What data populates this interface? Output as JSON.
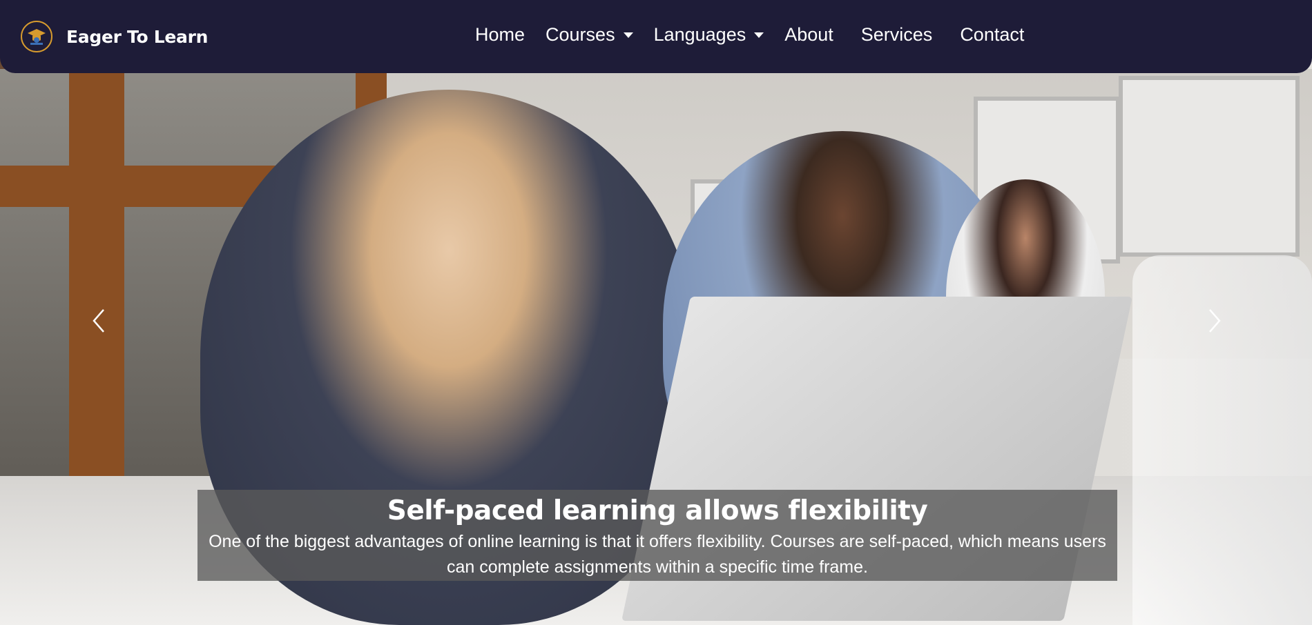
{
  "brand": {
    "name": "Eager To Learn",
    "logo_icon": "graduate-logo-icon"
  },
  "nav": {
    "items": [
      {
        "label": "Home",
        "dropdown": false
      },
      {
        "label": "Courses",
        "dropdown": true
      },
      {
        "label": "Languages",
        "dropdown": true
      },
      {
        "label": "About",
        "dropdown": false
      },
      {
        "label": "Services",
        "dropdown": false
      },
      {
        "label": "Contact",
        "dropdown": false
      }
    ]
  },
  "carousel": {
    "prev_icon": "chevron-left-icon",
    "next_icon": "chevron-right-icon",
    "caption": {
      "title": "Self-paced learning allows flexibility",
      "text": "One of the biggest advantages of online learning is that it offers flexibility. Courses are self-paced, which means users can complete assignments within a specific time frame."
    }
  },
  "colors": {
    "navbar_bg": "#1e1c38",
    "text": "#ffffff",
    "logo_accent": "#d79b2e"
  }
}
